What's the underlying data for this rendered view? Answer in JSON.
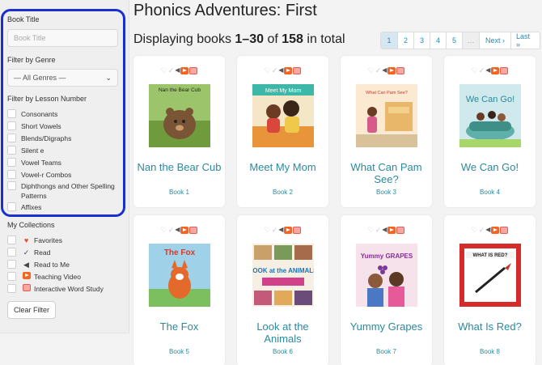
{
  "app": {
    "title": "Phonics Adventures: First"
  },
  "results": {
    "prefix": "Displaying books ",
    "range": "1–30",
    "of": " of ",
    "total": "158",
    "suffix": " in total"
  },
  "pagination": {
    "pages": [
      "1",
      "2",
      "3",
      "4",
      "5",
      "…",
      "Next ›",
      "Last »"
    ],
    "active": "1"
  },
  "sidebar": {
    "book_title_label": "Book Title",
    "book_title_placeholder": "Book Title",
    "genre_label": "Filter by Genre",
    "genre_value": "— All Genres —",
    "lesson_label": "Filter by Lesson Number",
    "lessons": [
      "Consonants",
      "Short Vowels",
      "Blends/Digraphs",
      "Silent e",
      "Vowel Teams",
      "Vowel-r Combos",
      "Diphthongs and Other Spelling Patterns",
      "Affixes"
    ],
    "collections_label": "My Collections",
    "collections": [
      {
        "label": "Favorites",
        "icon": "heart-icon"
      },
      {
        "label": "Read",
        "icon": "check-icon"
      },
      {
        "label": "Read to Me",
        "icon": "speaker-icon"
      },
      {
        "label": "Teaching Video",
        "icon": "play-icon"
      },
      {
        "label": "Interactive Word Study",
        "icon": "word-study-icon"
      }
    ],
    "clear_button": "Clear Filter"
  },
  "books": [
    {
      "title": "Nan the Bear Cub",
      "number": "Book 1",
      "cover_text": "Nan the Bear Cub"
    },
    {
      "title": "Meet My Mom",
      "number": "Book 2",
      "cover_text": "Meet My Mom"
    },
    {
      "title": "What Can Pam See?",
      "number": "Book 3",
      "cover_text": "What Can Pam See?"
    },
    {
      "title": "We Can Go!",
      "number": "Book 4",
      "cover_text": "We Can Go!"
    },
    {
      "title": "The Fox",
      "number": "Book 5",
      "cover_text": "The Fox"
    },
    {
      "title": "Look at the Animals",
      "number": "Book 6",
      "cover_text": "LOOK at the ANIMALS"
    },
    {
      "title": "Yummy Grapes",
      "number": "Book 7",
      "cover_text": "Yummy GRAPES"
    },
    {
      "title": "What Is Red?",
      "number": "Book 8",
      "cover_text": "WHAT IS RED?"
    }
  ],
  "colors": {
    "highlight": "#1a2fd1",
    "link": "#2b8a9e",
    "heart": "#e8482f",
    "video": "#f26522"
  }
}
